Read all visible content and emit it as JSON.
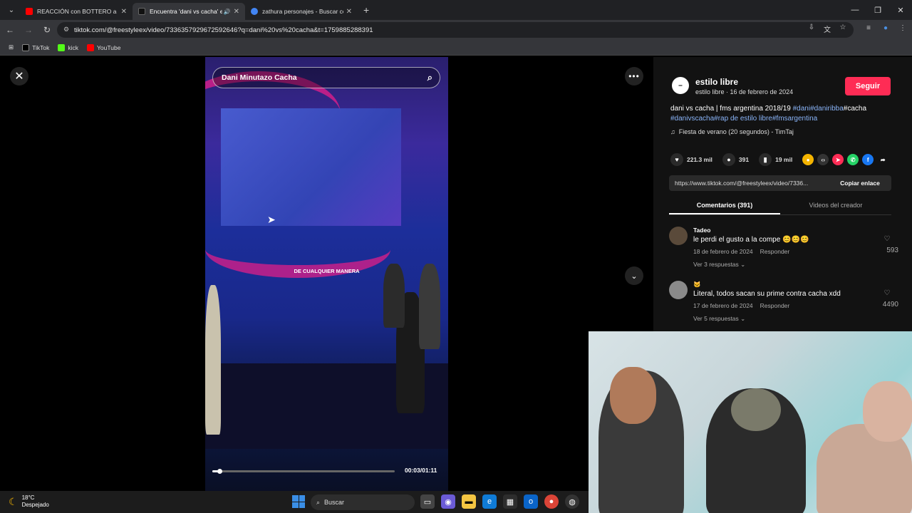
{
  "browser": {
    "tabs": [
      {
        "title": "REACCIÓN con BOTTERO a MA...",
        "active": false,
        "favicon_color": "#ff0000"
      },
      {
        "title": "Encuentra 'dani vs cacha' en",
        "active": true,
        "favicon_color": "#000000"
      },
      {
        "title": "zathura personajes - Buscar con",
        "active": false,
        "favicon_color": "#4285f4"
      }
    ],
    "url": "tiktok.com/@freestyleex/video/7336357929672592646?q=dani%20vs%20cacha&t=1759885288391",
    "bookmarks": [
      {
        "label": "TikTok",
        "color": "#000000"
      },
      {
        "label": "kick",
        "color": "#53fc18"
      },
      {
        "label": "YouTube",
        "color": "#ff0000"
      }
    ]
  },
  "video": {
    "search_text": "Dani Minutazo Cacha",
    "caption": "DE CUALQUIER MANERA",
    "time": "00:03/01:11",
    "progress": 0.04
  },
  "panel": {
    "author": "estilo libre",
    "author_sub": "estilo libre · 16 de febrero de 2024",
    "follow_label": "Seguir",
    "desc_plain": "dani vs cacha | fms argentina 2018/19 ",
    "desc_tag1": "#dani",
    "desc_tag2": "#daniribba",
    "desc_plain2": "#cacha",
    "desc_tag3": "#danivscacha",
    "desc_tag4": "#rap de estilo libre",
    "desc_tag5": "#fmsargentina",
    "music": "Fiesta de verano (20 segundos) - TimTaj",
    "likes": "221.3 mil",
    "comments_count": "391",
    "saves": "19 mil",
    "link": "https://www.tiktok.com/@freestyleex/video/7336...",
    "copy_label": "Copiar enlace",
    "tab_comments": "Comentarios (391)",
    "tab_creator": "Videos del creador",
    "comments": [
      {
        "name": "Tadeo",
        "text": "le perdi el gusto a la compe 😊😊😊",
        "date": "18 de febrero de 2024",
        "reply": "Responder",
        "more": "Ver 3 respuestas ⌄",
        "likes": "593"
      },
      {
        "name": "🐱",
        "text": "Literal, todos sacan su prime contra cacha xdd",
        "date": "17 de febrero de 2024",
        "reply": "Responder",
        "more": "Ver 5 respuestas ⌄",
        "likes": "4490"
      }
    ]
  },
  "taskbar": {
    "temp": "18°C",
    "weather": "Despejado",
    "search": "Buscar"
  },
  "colors": {
    "accent": "#fe2c55",
    "tag": "#8ab4f8"
  }
}
